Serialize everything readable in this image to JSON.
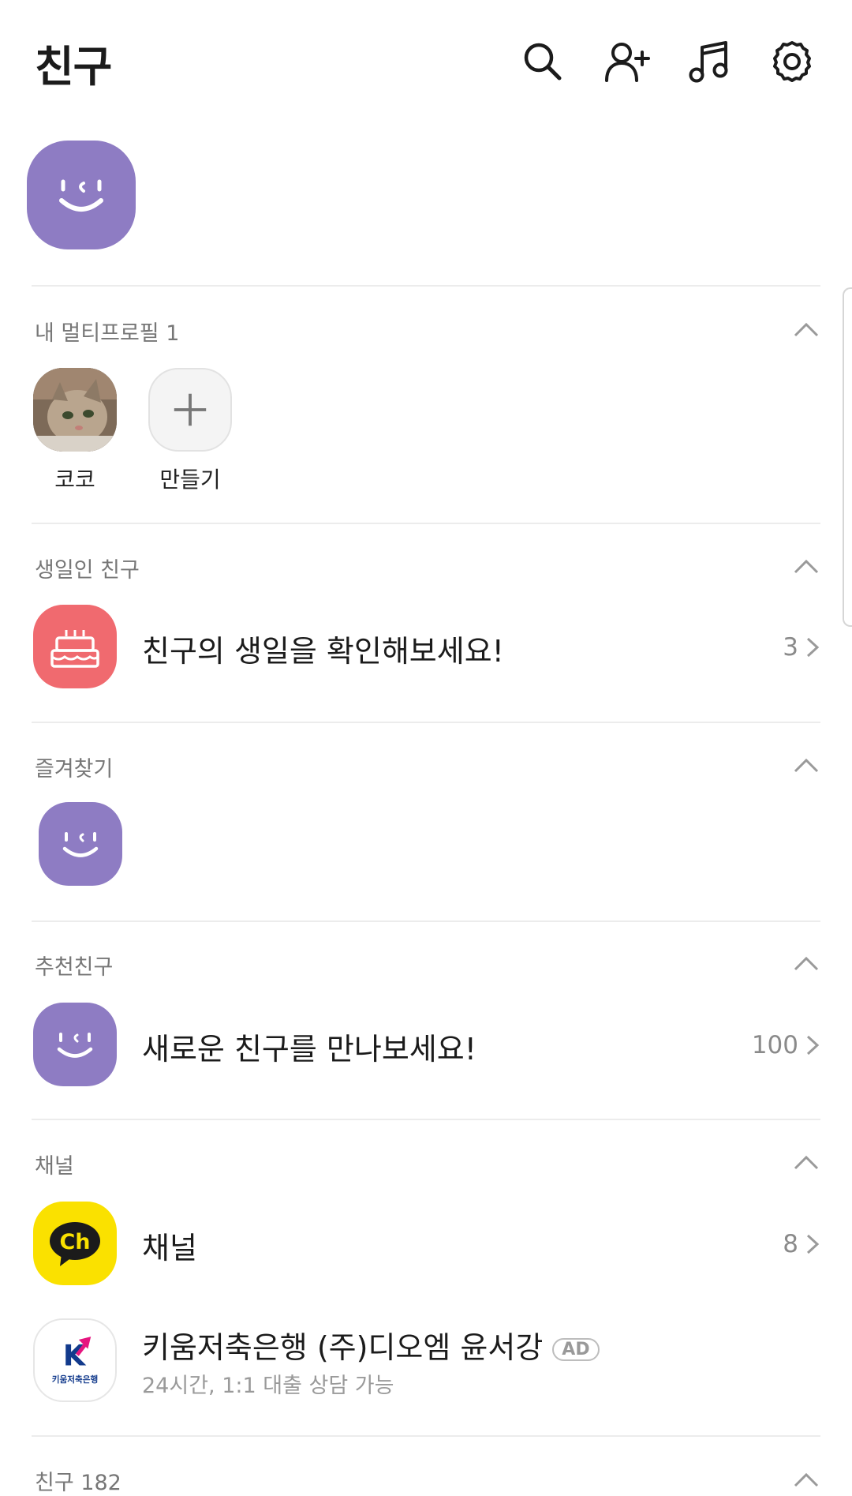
{
  "header": {
    "title": "친구",
    "icons": [
      "search-icon",
      "add-friend-icon",
      "music-icon",
      "settings-icon"
    ]
  },
  "multiprofile": {
    "title": "내 멀티프로필 1",
    "items": [
      {
        "label": "코코"
      },
      {
        "label": "만들기"
      }
    ]
  },
  "birthday": {
    "title": "생일인 친구",
    "text": "친구의 생일을 확인해보세요!",
    "count": "3"
  },
  "favorites": {
    "title": "즐겨찾기"
  },
  "recommended": {
    "title": "추천친구",
    "text": "새로운 친구를 만나보세요!",
    "count": "100"
  },
  "channel": {
    "title": "채널",
    "text": "채널",
    "count": "8",
    "ad": {
      "name": "키움저축은행 (주)디오엠 윤서강",
      "badge": "AD",
      "subtitle": "24시간, 1:1 대출 상담 가능",
      "logo_text": "키움저축은행",
      "logo_letter": "K"
    }
  },
  "friends": {
    "title": "친구 182"
  },
  "colors": {
    "profile_purple": "#8e7cc3",
    "birthday_red": "#f06a6f",
    "channel_yellow": "#fae100",
    "divider": "#ececec"
  }
}
